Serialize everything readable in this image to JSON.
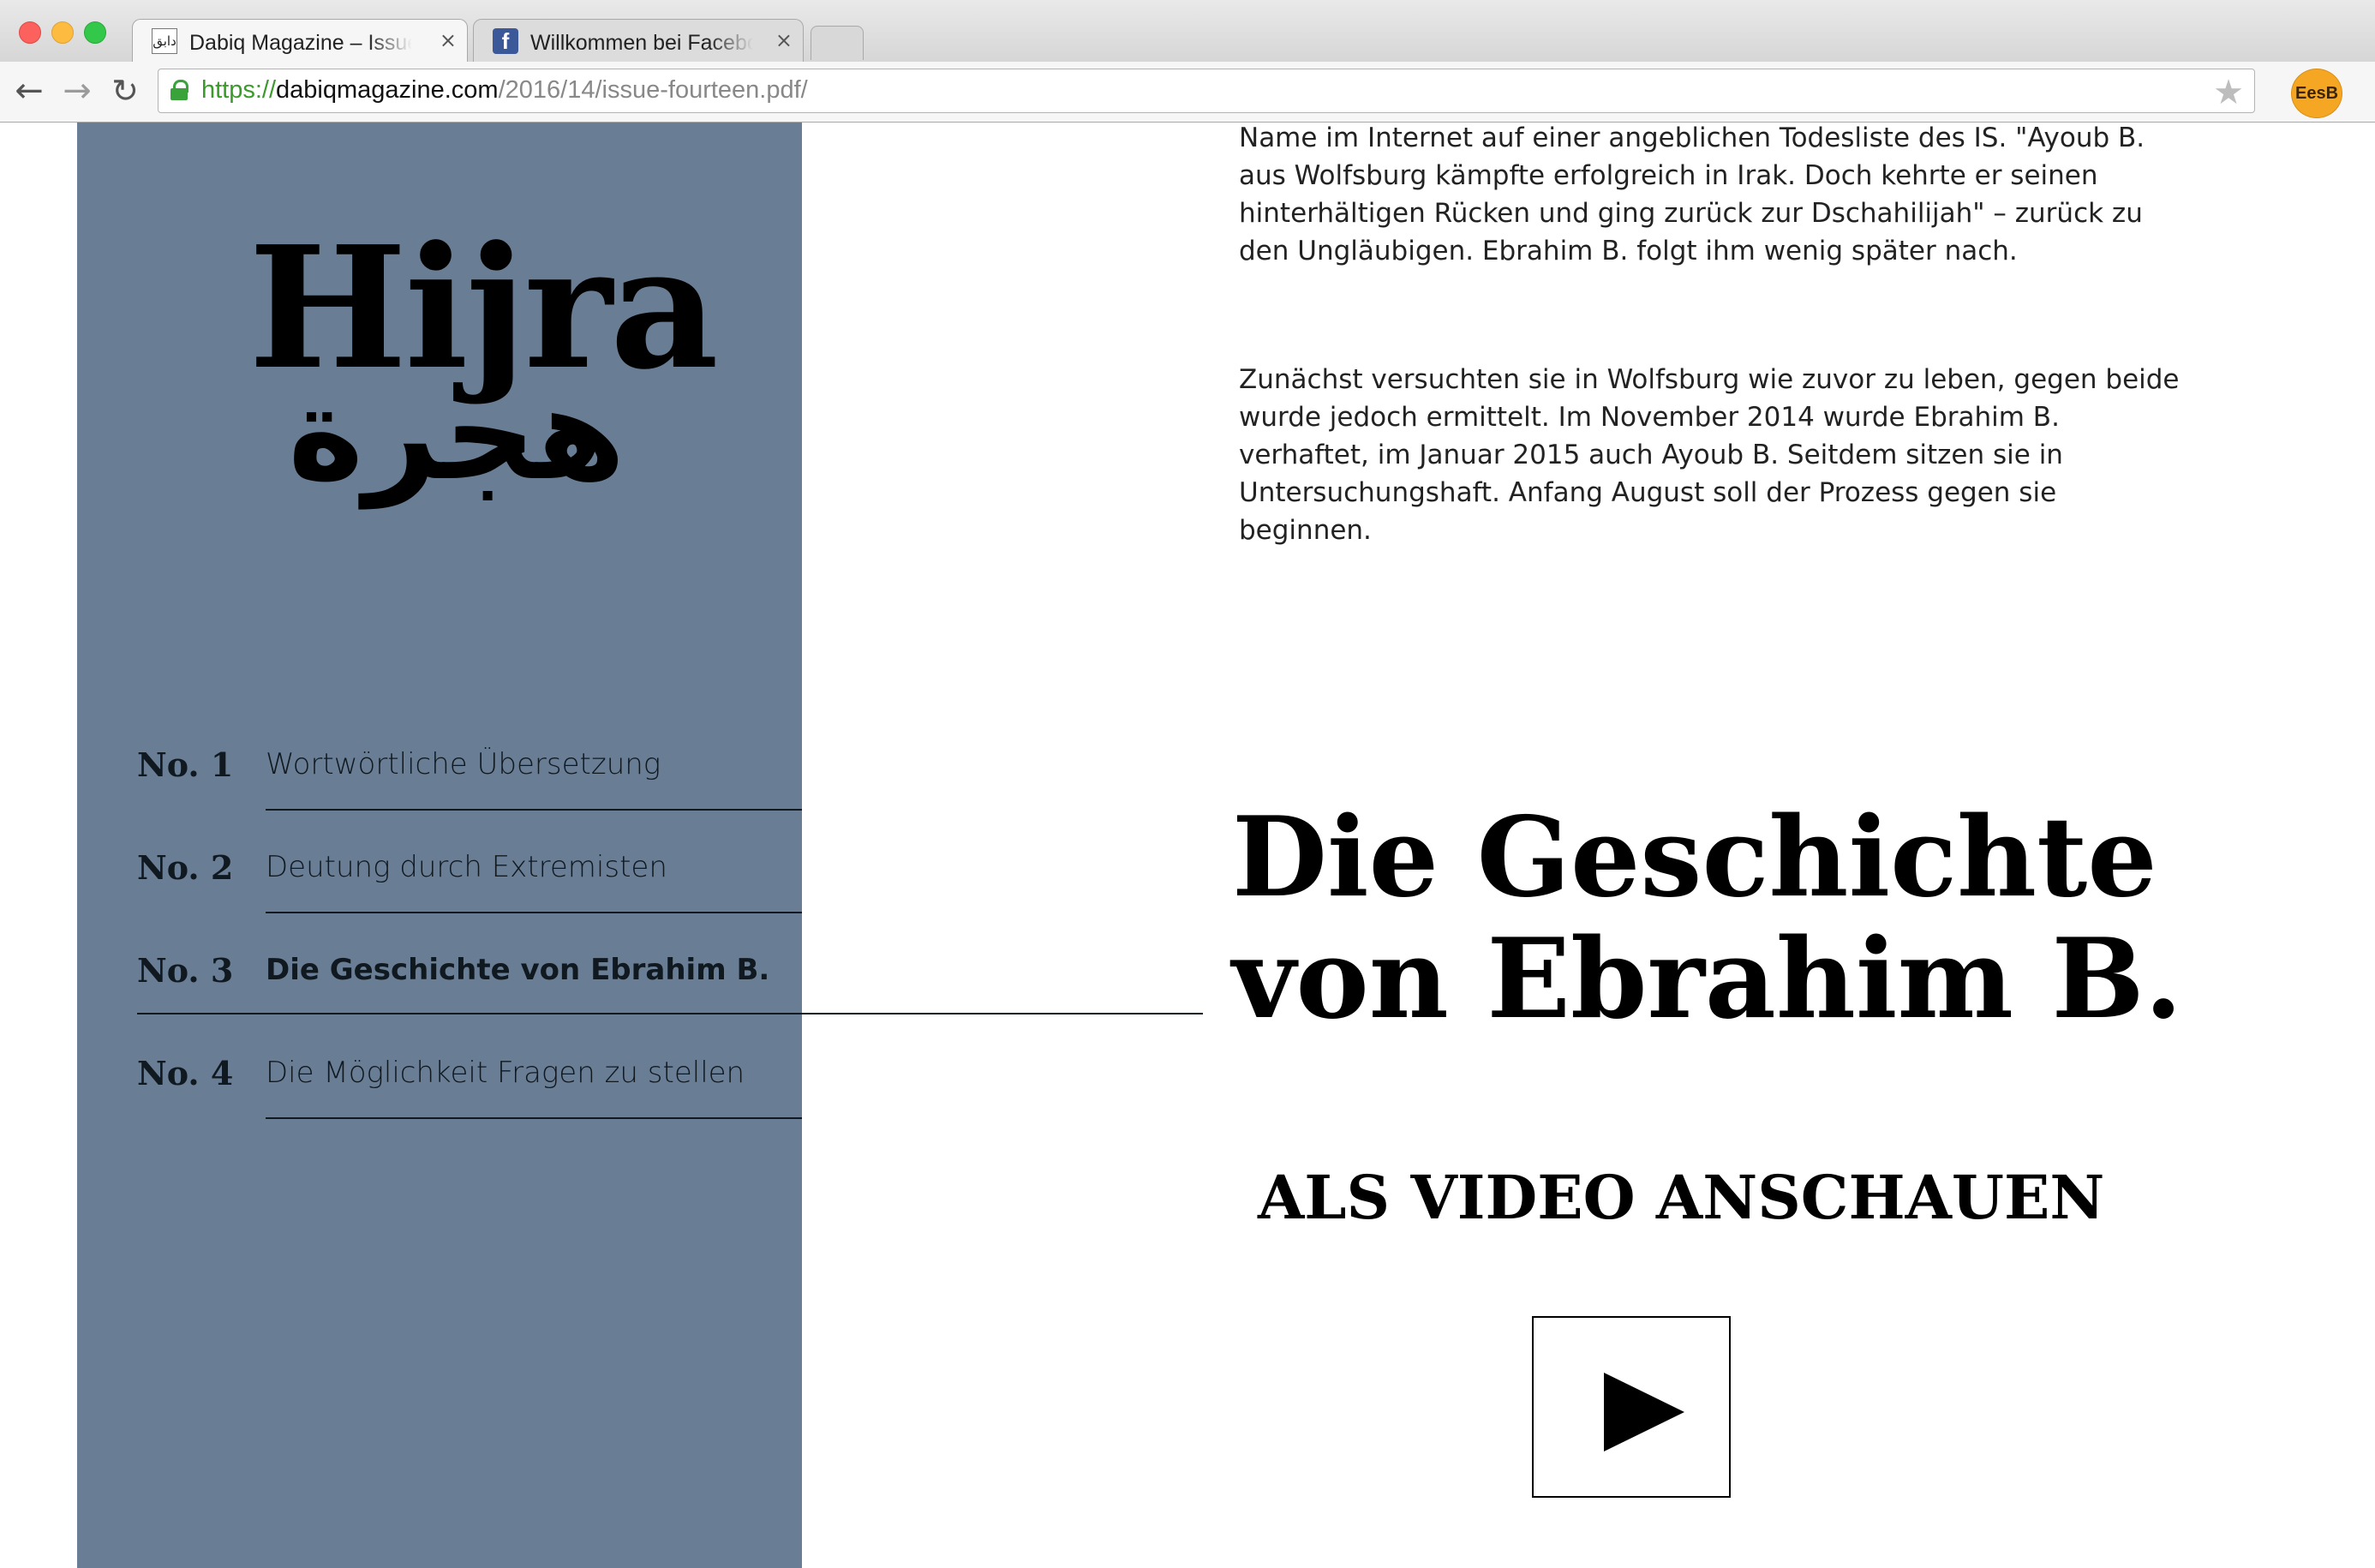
{
  "browser": {
    "tabs": [
      {
        "title": "Dabiq Magazine – Issue F",
        "icon": "dabiq-favicon",
        "close": "×",
        "active": true
      },
      {
        "title": "Willkommen bei Facebook",
        "icon": "facebook-favicon",
        "close": "×",
        "active": false
      }
    ],
    "url": {
      "scheme": "https://",
      "host": "dabiqmagazine.com",
      "path": "/2016/14/issue-fourteen.pdf/"
    },
    "profile_label": "EesB",
    "icons": {
      "back": "←",
      "forward": "→",
      "reload": "↻",
      "star": "★",
      "fb": "f",
      "dabiq": "دابق"
    }
  },
  "logo": {
    "latin": "Hijra",
    "arabic": "هجرة"
  },
  "toc": [
    {
      "no": "No. 1",
      "label": "Wortwörtliche Übersetzung",
      "current": false
    },
    {
      "no": "No. 2",
      "label": "Deutung durch Extremisten",
      "current": false
    },
    {
      "no": "No. 3",
      "label": "Die Geschichte von Ebrahim B.",
      "current": true
    },
    {
      "no": "No. 4",
      "label": "Die Möglichkeit Fragen zu stellen",
      "current": false
    }
  ],
  "article": {
    "paragraph1": "Name im Internet auf einer angeblichen Todesliste des IS. \"Ayoub B. aus Wolfsburg kämpfte erfolgreich in Irak. Doch kehrte er seinen hinterhältigen Rücken und ging zurück zur Dschahilijah\" – zurück zu den Ungläubigen. Ebrahim B. folgt ihm wenig später nach.",
    "paragraph2": "Zunächst versuchten sie in Wolfsburg wie zuvor zu leben, gegen beide wurde jedoch ermittelt. Im November 2014 wurde Ebrahim B. verhaftet, im Januar 2015 auch Ayoub B. Seitdem sitzen sie in Untersuchungshaft. Anfang August soll der Prozess gegen sie beginnen.",
    "headline_line1": "Die Geschichte",
    "headline_line2": "von Ebrahim B.",
    "video_cta": "ALS VIDEO ANSCHAUEN",
    "play_icon": "play-triangle"
  },
  "colors": {
    "sidebar": "#697e95",
    "text": "#101820",
    "profile": "#f5a623",
    "secure": "#3aa23a"
  }
}
